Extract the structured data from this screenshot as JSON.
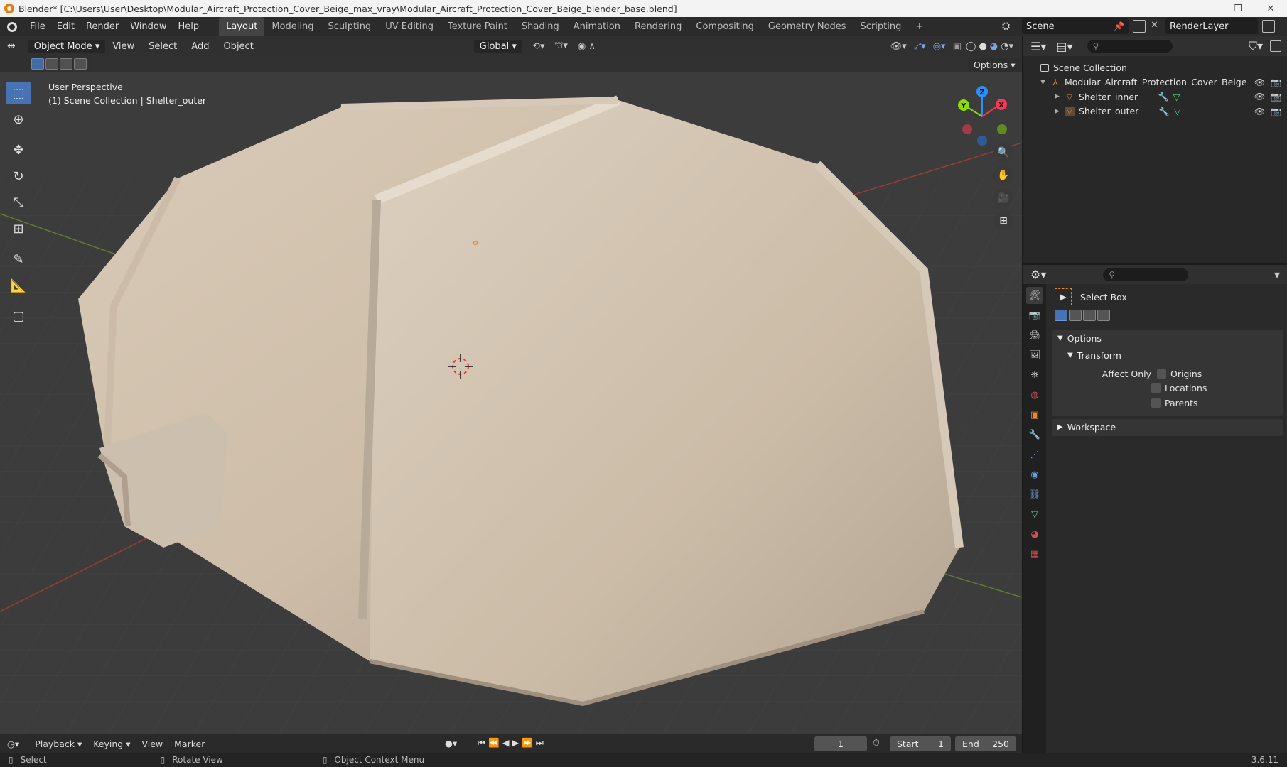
{
  "window": {
    "title": "Blender* [C:\\Users\\User\\Desktop\\Modular_Aircraft_Protection_Cover_Beige_max_vray\\Modular_Aircraft_Protection_Cover_Beige_blender_base.blend]",
    "controls": [
      "—",
      "❐",
      "✕"
    ]
  },
  "menubar": {
    "menus": [
      "File",
      "Edit",
      "Render",
      "Window",
      "Help"
    ],
    "workspaces": [
      "Layout",
      "Modeling",
      "Sculpting",
      "UV Editing",
      "Texture Paint",
      "Shading",
      "Animation",
      "Rendering",
      "Compositing",
      "Geometry Nodes",
      "Scripting"
    ],
    "active_workspace": "Layout",
    "add_tab": "+",
    "scene": "Scene",
    "render_layer": "RenderLayer"
  },
  "viewport": {
    "mode": "Object Mode",
    "menus": [
      "View",
      "Select",
      "Add",
      "Object"
    ],
    "orientation": "Global",
    "info_line1": "User Perspective",
    "info_line2": "(1) Scene Collection | Shelter_outer",
    "options_label": "Options",
    "gizmo_axes": {
      "z": "Z",
      "y": "Y",
      "x": "X"
    },
    "tools": [
      "select-box",
      "cursor",
      "move",
      "rotate",
      "scale",
      "transform",
      "annotate",
      "measure",
      "add-cube"
    ]
  },
  "colors": {
    "accent": "#4772b3",
    "axis_x": "#ff3352",
    "axis_y": "#8bdc00",
    "axis_z": "#2890ff",
    "object": "#e88a2c",
    "cover": "#cfc0ad"
  },
  "timeline": {
    "menus": [
      "Playback",
      "Keying",
      "View",
      "Marker"
    ],
    "current_frame": "1",
    "start_label": "Start",
    "start": "1",
    "end_label": "End",
    "end": "250"
  },
  "statusbar": {
    "select": "Select",
    "rotate": "Rotate View",
    "context": "Object Context Menu",
    "version": "3.6.11"
  },
  "outliner": {
    "root": "Scene Collection",
    "items": [
      {
        "name": "Modular_Aircraft_Protection_Cover_Beige",
        "level": 1
      },
      {
        "name": "Shelter_inner",
        "level": 2
      },
      {
        "name": "Shelter_outer",
        "level": 2
      }
    ]
  },
  "properties": {
    "tool_name": "Select Box",
    "options_label": "Options",
    "transform_label": "Transform",
    "affect_only_label": "Affect Only",
    "checkboxes": [
      "Origins",
      "Locations",
      "Parents"
    ],
    "workspace_label": "Workspace"
  }
}
